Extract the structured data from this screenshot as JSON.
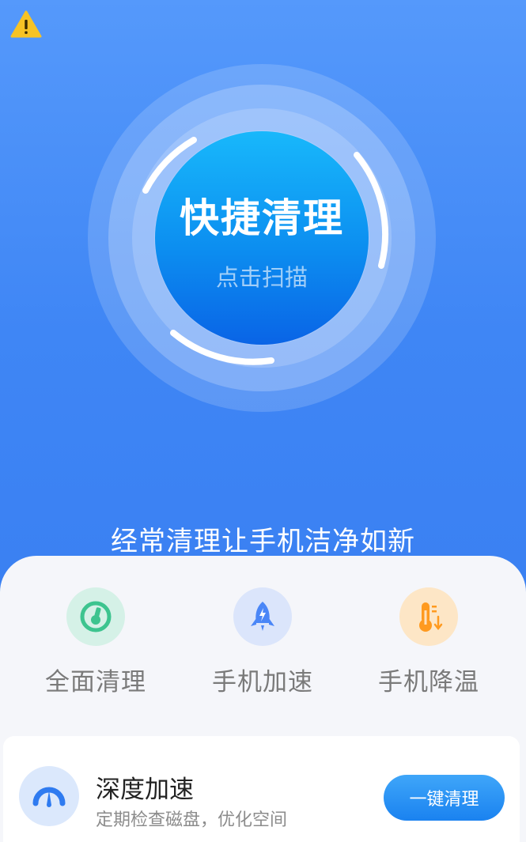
{
  "hero": {
    "scan_title": "快捷清理",
    "scan_subtitle": "点击扫描",
    "tagline": "经常清理让手机洁净如新"
  },
  "tools": [
    {
      "label": "全面清理",
      "icon": "full-clean-icon",
      "color": "#4ed0a0"
    },
    {
      "label": "手机加速",
      "icon": "rocket-icon",
      "color": "#4a86f7"
    },
    {
      "label": "手机降温",
      "icon": "thermometer-icon",
      "color": "#ff9a1f"
    }
  ],
  "card": {
    "title": "深度加速",
    "description": "定期检查磁盘，优化空间",
    "button_label": "一键清理",
    "icon": "speedometer-icon"
  },
  "colors": {
    "hero_top": "#5599fb",
    "hero_bottom": "#3a80f2",
    "accent": "#1a82f0",
    "warning": "#f7c325"
  }
}
